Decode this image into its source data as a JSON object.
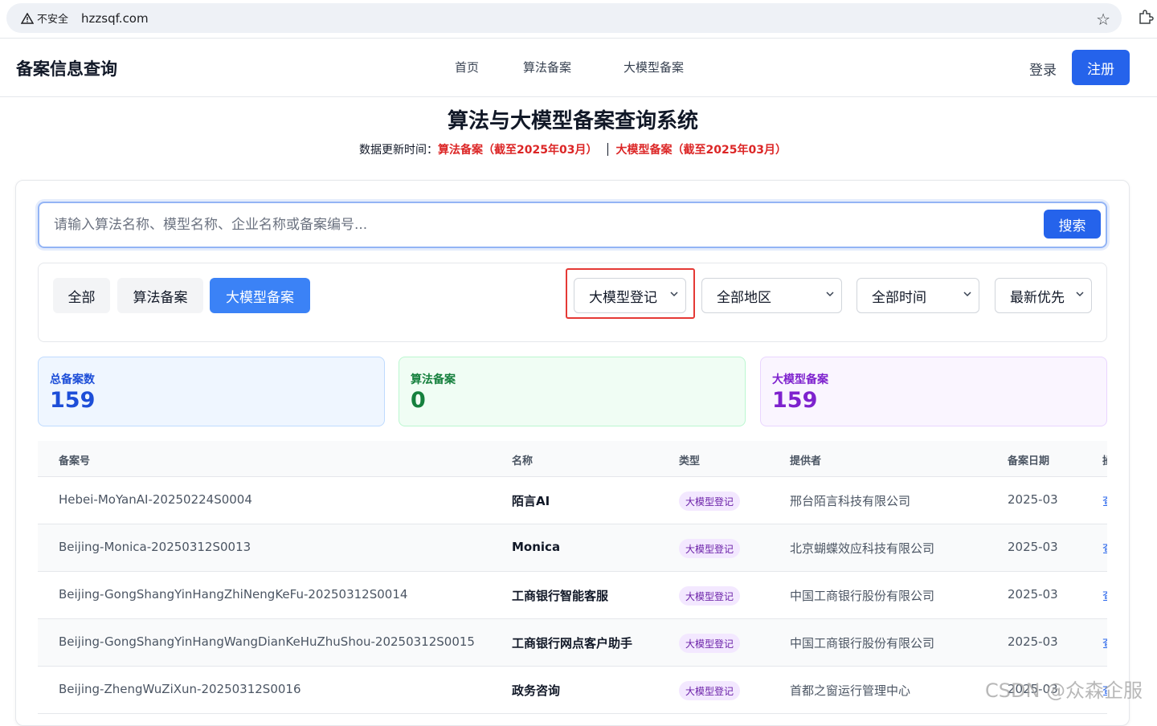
{
  "browser": {
    "insecure_label": "不安全",
    "url": "hzzsqf.com"
  },
  "header": {
    "brand": "备案信息查询",
    "nav": [
      "首页",
      "算法备案",
      "大模型备案"
    ],
    "login": "登录",
    "register": "注册"
  },
  "hero": {
    "title": "算法与大模型备案查询系统",
    "update_prefix": "数据更新时间：",
    "update_algo": "算法备案（截至2025年03月）",
    "update_llm": "大模型备案（截至2025年03月）"
  },
  "search": {
    "placeholder": "请输入算法名称、模型名称、企业名称或备案编号...",
    "button": "搜索"
  },
  "filters": {
    "tabs": [
      "全部",
      "算法备案",
      "大模型备案"
    ],
    "active_tab": "大模型备案",
    "type_select": "大模型登记",
    "region_select": "全部地区",
    "time_select": "全部时间",
    "sort_select": "最新优先"
  },
  "stats": {
    "total_label": "总备案数",
    "total_value": "159",
    "algo_label": "算法备案",
    "algo_value": "0",
    "llm_label": "大模型备案",
    "llm_value": "159"
  },
  "table": {
    "headers": [
      "备案号",
      "名称",
      "类型",
      "提供者",
      "备案日期",
      "操"
    ],
    "rows": [
      {
        "id": "Hebei-MoYanAI-20250224S0004",
        "name": "陌言AI",
        "type": "大模型登记",
        "provider": "邢台陌言科技有限公司",
        "date": "2025-03",
        "action": "查"
      },
      {
        "id": "Beijing-Monica-20250312S0013",
        "name": "Monica",
        "type": "大模型登记",
        "provider": "北京蝴蝶效应科技有限公司",
        "date": "2025-03",
        "action": "查"
      },
      {
        "id": "Beijing-GongShangYinHangZhiNengKeFu-20250312S0014",
        "name": "工商银行智能客服",
        "type": "大模型登记",
        "provider": "中国工商银行股份有限公司",
        "date": "2025-03",
        "action": "查"
      },
      {
        "id": "Beijing-GongShangYinHangWangDianKeHuZhuShou-20250312S0015",
        "name": "工商银行网点客户助手",
        "type": "大模型登记",
        "provider": "中国工商银行股份有限公司",
        "date": "2025-03",
        "action": "查"
      },
      {
        "id": "Beijing-ZhengWuZiXun-20250312S0016",
        "name": "政务咨询",
        "type": "大模型登记",
        "provider": "首都之窗运行管理中心",
        "date": "2025-03",
        "action": "查"
      }
    ]
  },
  "watermark": "CSDN @众森企服",
  "colors": {
    "primary": "#2563eb",
    "highlight_border": "#e53935",
    "update_red": "#dc2626"
  },
  "icons": {
    "warning": "warning-triangle-icon",
    "star": "bookmark-star-icon",
    "extension": "extension-puzzle-icon",
    "chevron": "chevron-down-icon"
  }
}
